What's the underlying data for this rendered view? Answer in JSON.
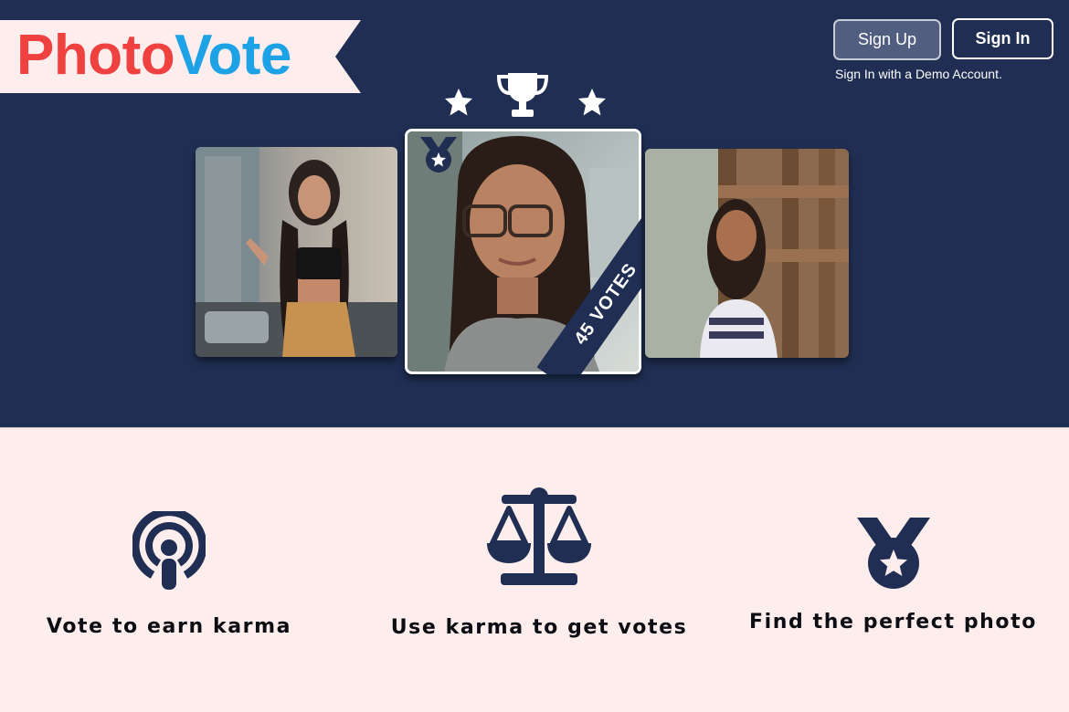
{
  "logo": {
    "part1": "Photo",
    "part2": "Vote",
    "color1": "#f04141",
    "color2": "#1ea2e6"
  },
  "header": {
    "signup_label": "Sign Up",
    "signin_label": "Sign In",
    "demo_link": "Sign In with a Demo Account."
  },
  "hero": {
    "background": "#1f2e52",
    "featured_votes_label": "45 VOTES",
    "icons": [
      "star-icon",
      "trophy-icon",
      "star-icon",
      "medal-icon"
    ],
    "photos": [
      {
        "name": "photo-left"
      },
      {
        "name": "photo-featured"
      },
      {
        "name": "photo-right"
      }
    ]
  },
  "features": [
    {
      "icon": "podcast-icon",
      "label": "Vote to earn karma"
    },
    {
      "icon": "scale-icon",
      "label": "Use karma to get votes"
    },
    {
      "icon": "medal-icon",
      "label": "Find the perfect photo"
    }
  ]
}
